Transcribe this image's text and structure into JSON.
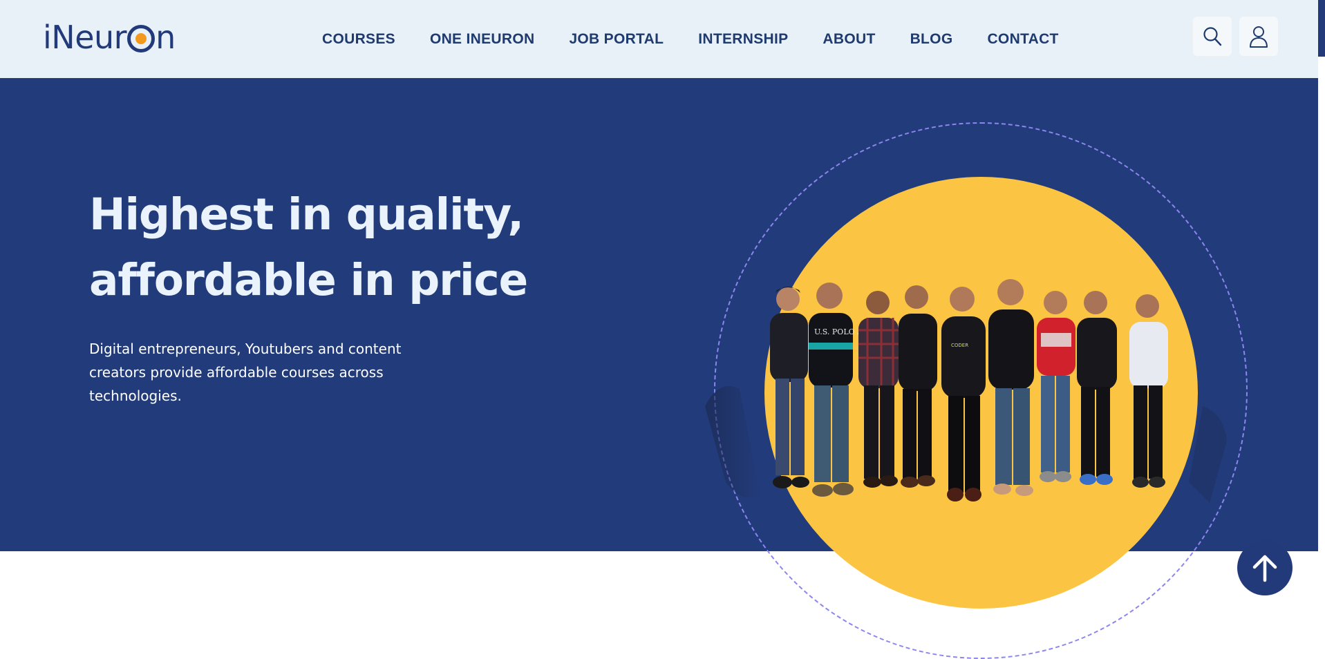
{
  "brand": {
    "logo_text_before": "iNeur",
    "logo_text_after": "n",
    "colors": {
      "navy": "#223b7a",
      "nav_bg": "#e8f1f7",
      "accent_yellow": "#fcc443",
      "accent_orange": "#f39a1e",
      "ring": "#8c86ee"
    }
  },
  "nav": {
    "items": [
      {
        "label": "COURSES"
      },
      {
        "label": "ONE INEURON"
      },
      {
        "label": "JOB PORTAL"
      },
      {
        "label": "INTERNSHIP"
      },
      {
        "label": "ABOUT"
      },
      {
        "label": "BLOG"
      },
      {
        "label": "CONTACT"
      }
    ],
    "icons": [
      "search-icon",
      "user-icon"
    ]
  },
  "hero": {
    "headline_line1": "Highest in quality,",
    "headline_line2": "affordable in price",
    "subtext": "Digital entrepreneurs, Youtubers and content creators provide affordable courses across technologies.",
    "shirt_texts": [
      "U.S. POLO ASS",
      "CODER"
    ]
  },
  "scroll_top": {
    "icon": "arrow-up-icon"
  }
}
